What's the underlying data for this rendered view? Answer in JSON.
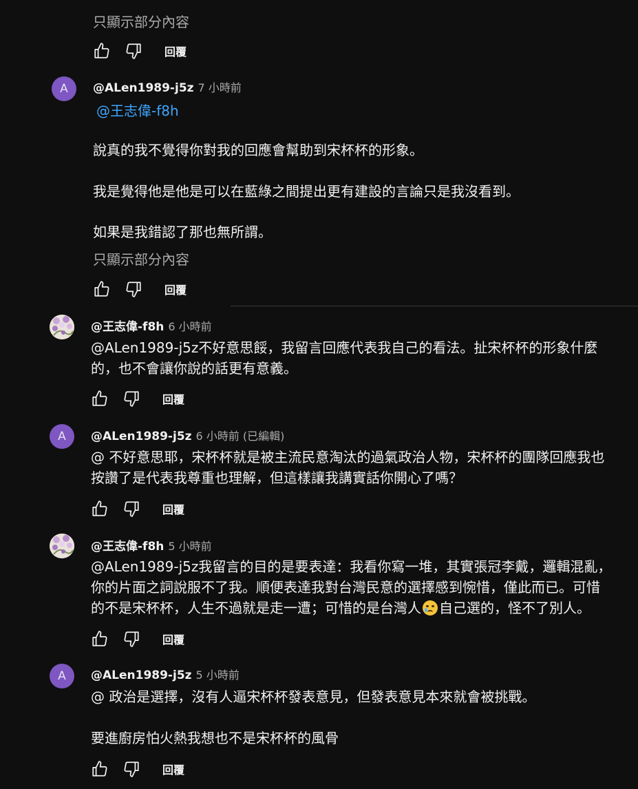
{
  "show_more": "只顯示部分內容",
  "reply_label": "回覆",
  "comments": [
    {
      "author": "",
      "time": "",
      "lines": []
    },
    {
      "avatar_letter": "A",
      "author": "@ALen1989-j5z",
      "time": "7 小時前",
      "mention": "@王志偉-f8h",
      "paragraphs": [
        "說真的我不覺得你對我的回應會幫助到宋杯杯的形象。",
        "我是覺得他是他是可以在藍綠之間提出更有建設的言論只是我沒看到。",
        "如果是我錯認了那也無所謂。"
      ]
    },
    {
      "author": "@王志偉-f8h",
      "time": "6 小時前",
      "lines": [
        "@ALen1989-j5z不好意思餒，我留言回應代表我自己的看法。扯宋杯杯的形象什麼",
        "的，也不會讓你說的話更有意義。"
      ]
    },
    {
      "avatar_letter": "A",
      "author": "@ALen1989-j5z",
      "time": "6 小時前 (已編輯)",
      "lines": [
        "@ 不好意思耶，宋杯杯就是被主流民意淘汰的過氣政治人物，宋杯杯的團隊回應我也",
        "按讚了是代表我尊重也理解，但這樣讓我講實話你開心了嗎？"
      ]
    },
    {
      "author": "@王志偉-f8h",
      "time": "5 小時前",
      "lines": [
        "@ALen1989-j5z我留言的目的是要表達：我看你寫一堆，其實張冠李戴，邏輯混亂，",
        "你的片面之詞說服不了我。順便表達我對台灣民意的選擇感到惋惜，僅此而已。可惜"
      ],
      "line3_before": "的不是宋杯杯，人生不過就是走一遭；可惜的是台灣人",
      "line3_after": "自己選的，怪不了別人。",
      "emoji": "crying-face-emoji"
    },
    {
      "avatar_letter": "A",
      "author": "@ALen1989-j5z",
      "time": "5 小時前",
      "paragraphs": [
        "@ 政治是選擇，沒有人逼宋杯杯發表意見，但發表意見本來就會被挑戰。",
        "要進廚房怕火熱我想也不是宋杯杯的風骨"
      ]
    }
  ]
}
